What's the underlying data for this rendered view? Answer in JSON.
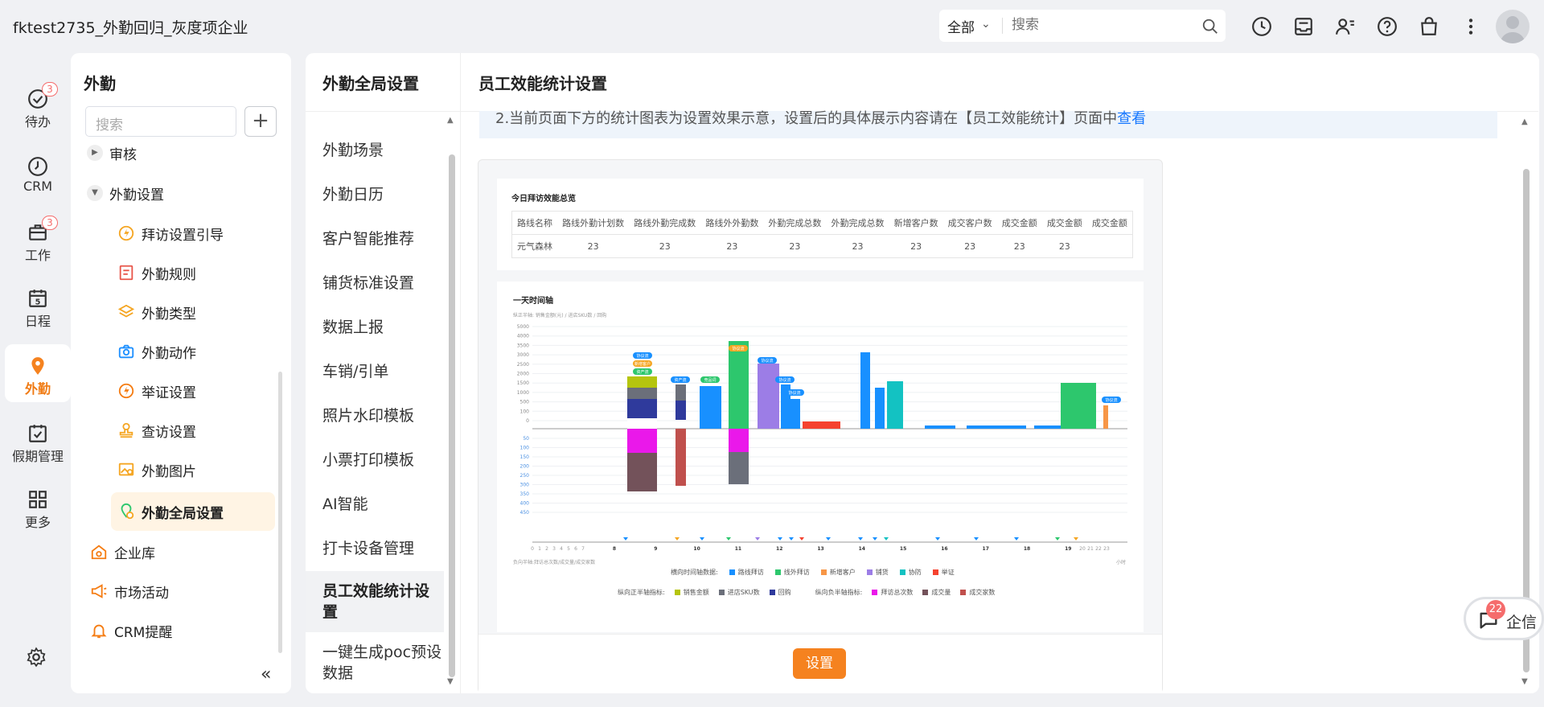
{
  "app": {
    "enterprise_name": "fktest2735_外勤回归_灰度项企业",
    "search_scope": "全部",
    "search_placeholder": "搜索"
  },
  "rail": [
    {
      "label": "待办",
      "icon": "todo-check-icon",
      "badge": "3"
    },
    {
      "label": "CRM",
      "icon": "crm-clock-icon"
    },
    {
      "label": "工作",
      "icon": "work-briefcase-icon",
      "badge": "3"
    },
    {
      "label": "日程",
      "icon": "calendar-icon",
      "day": "5"
    },
    {
      "label": "外勤",
      "icon": "location-pin-icon",
      "active": true
    },
    {
      "label": "假期管理",
      "icon": "holiday-calendar-icon"
    },
    {
      "label": "更多",
      "icon": "grid-more-icon"
    }
  ],
  "panel1": {
    "title": "外勤",
    "search_placeholder": "搜索",
    "items": [
      {
        "label": "审核",
        "level": 1,
        "expand": "collapsed"
      },
      {
        "label": "外勤设置",
        "level": 1,
        "expand": "expanded"
      },
      {
        "label": "拜访设置引导",
        "level": 2,
        "icon": "guide-bolt-icon"
      },
      {
        "label": "外勤规则",
        "level": 2,
        "icon": "rule-doc-icon"
      },
      {
        "label": "外勤类型",
        "level": 2,
        "icon": "layers-icon"
      },
      {
        "label": "外勤动作",
        "level": 2,
        "icon": "camera-icon"
      },
      {
        "label": "举证设置",
        "level": 2,
        "icon": "evidence-bolt-icon"
      },
      {
        "label": "查访设置",
        "level": 2,
        "icon": "stamp-icon"
      },
      {
        "label": "外勤图片",
        "level": 2,
        "icon": "image-settings-icon"
      },
      {
        "label": "外勤全局设置",
        "level": 2,
        "icon": "global-settings-icon",
        "active": true
      },
      {
        "label": "企业库",
        "level": 1,
        "icon": "enterprise-library-icon"
      },
      {
        "label": "市场活动",
        "level": 1,
        "icon": "megaphone-icon"
      },
      {
        "label": "CRM提醒",
        "level": 1,
        "icon": "bell-icon"
      }
    ]
  },
  "panel2": {
    "title": "外勤全局设置",
    "items": [
      {
        "label": "外勤场景"
      },
      {
        "label": "外勤日历"
      },
      {
        "label": "客户智能推荐"
      },
      {
        "label": "铺货标准设置"
      },
      {
        "label": "数据上报"
      },
      {
        "label": "车销/引单"
      },
      {
        "label": "照片水印模板"
      },
      {
        "label": "小票打印模板"
      },
      {
        "label": "AI智能"
      },
      {
        "label": "打卡设备管理"
      },
      {
        "label": "员工效能统计设置",
        "active": true
      },
      {
        "label": "一键生成poc预设数据"
      }
    ]
  },
  "main": {
    "title": "员工效能统计设置",
    "notice_text": "2.当前页面下方的统计图表为设置效果示意，设置后的具体展示内容请在【员工效能统计】页面中",
    "notice_link": "查看",
    "set_button": "设置"
  },
  "summary": {
    "title": "今日拜访效能总览",
    "headers": [
      "路线名称",
      "路线外勤计划数",
      "路线外勤完成数",
      "路线外外勤数",
      "外勤完成总数",
      "外勤完成总数",
      "新增客户数",
      "成交客户数",
      "成交金额",
      "成交金额",
      "成交金额"
    ],
    "row": [
      "元气森林",
      "23",
      "23",
      "23",
      "23",
      "23",
      "23",
      "23",
      "23",
      "23",
      ""
    ]
  },
  "chart_data": {
    "type": "bar",
    "title": "一天时间轴",
    "subtitle": "纵正半轴: 销售金额(元) / 进店SKU数 / 回购",
    "neg_axis_note": "负向半轴:拜访总次数/成交量/成交家数",
    "x_unit": "小时",
    "yticks_pos": [
      "5000",
      "4000",
      "3500",
      "3000",
      "2500",
      "2000",
      "1500",
      "1000",
      "500",
      "100",
      "0"
    ],
    "yticks_neg": [
      "50",
      "100",
      "150",
      "200",
      "250",
      "300",
      "350",
      "400",
      "450"
    ],
    "hours_small": [
      "0",
      "1",
      "2",
      "3",
      "4",
      "5",
      "6",
      "7"
    ],
    "hours": [
      "8",
      "9",
      "10",
      "11",
      "12",
      "13",
      "14",
      "15",
      "16",
      "17",
      "18",
      "19"
    ],
    "hours_tail": [
      "20",
      "21",
      "22",
      "23"
    ],
    "markers": [
      "协议流",
      "新增客户",
      "资产流",
      "资产流",
      "竞品词",
      "协议流",
      "协议流",
      "协议流",
      "协议流"
    ],
    "legend_row1_label": "横向时间轴数据:",
    "legend_row1": [
      {
        "name": "路线拜访",
        "color": "#1890ff"
      },
      {
        "name": "线外拜访",
        "color": "#2dc76d"
      },
      {
        "name": "新增客户",
        "color": "#f79646"
      },
      {
        "name": "铺货",
        "color": "#9c7de6"
      },
      {
        "name": "协防",
        "color": "#13c2c2"
      },
      {
        "name": "举证",
        "color": "#f5422f"
      }
    ],
    "legend_row2_pos_label": "纵向正半轴指标:",
    "legend_row2_pos": [
      {
        "name": "销售金额",
        "color": "#b5c50e"
      },
      {
        "name": "进店SKU数",
        "color": "#6b6f7a"
      },
      {
        "name": "回购",
        "color": "#2f3a9c"
      }
    ],
    "legend_row2_neg_label": "纵向负半轴指标:",
    "legend_row2_neg": [
      {
        "name": "拜访总次数",
        "color": "#ea18ea"
      },
      {
        "name": "成交量",
        "color": "#73525a"
      },
      {
        "name": "成交家数",
        "color": "#c0504d"
      }
    ]
  },
  "qixin": {
    "label": "企信",
    "badge": "22"
  }
}
